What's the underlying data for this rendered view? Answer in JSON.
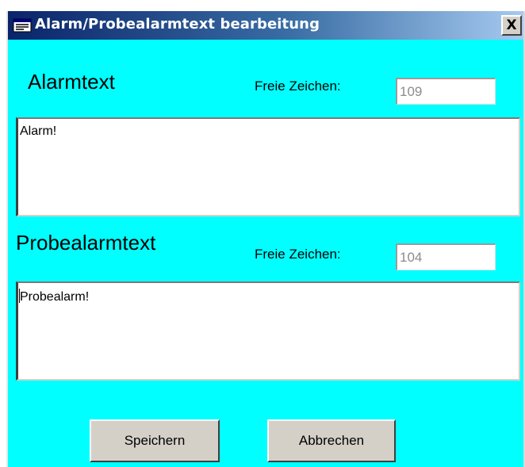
{
  "window": {
    "title": "Alarm/Probealarmtext bearbeitung",
    "title_icon": "form-window-icon",
    "close_label": "X",
    "background_color": "#00ffff"
  },
  "alarm": {
    "label": "Alarmtext",
    "free_chars_label": "Freie Zeichen:",
    "free_chars_value": "109",
    "text": "Alarm!"
  },
  "probealarm": {
    "label": "Probealarmtext",
    "free_chars_label": "Freie Zeichen:",
    "free_chars_value": "104",
    "text": "Probealarm!"
  },
  "buttons": {
    "save_label": "Speichern",
    "cancel_label": "Abbrechen"
  }
}
